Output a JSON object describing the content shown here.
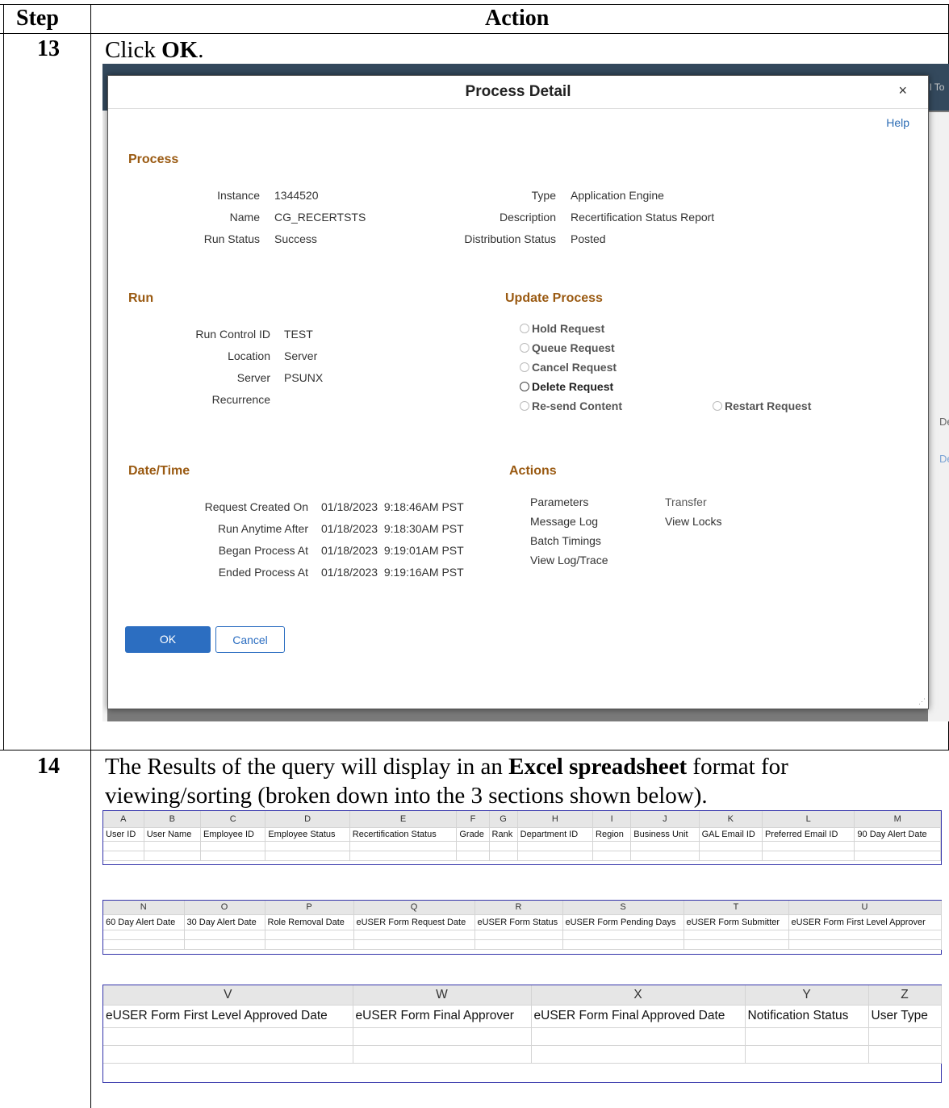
{
  "table_header": {
    "step": "Step",
    "action": "Action"
  },
  "steps": [
    {
      "number": "13",
      "text_before": "Click ",
      "text_bold": "OK",
      "text_after": "."
    },
    {
      "number": "14",
      "text_before": "The Results of the query will display in an ",
      "text_bold": "Excel spreadsheet",
      "text_after": " format for viewing/sorting (broken down into the 3 sections shown below)."
    }
  ],
  "background_fragments": {
    "top_right": "l To",
    "det1": "Det",
    "det2": "Det"
  },
  "dialog": {
    "title": "Process Detail",
    "close": "×",
    "help": "Help",
    "process": {
      "heading": "Process",
      "instance_label": "Instance",
      "instance": "1344520",
      "name_label": "Name",
      "name": "CG_RECERTSTS",
      "run_status_label": "Run Status",
      "run_status": "Success",
      "type_label": "Type",
      "type": "Application Engine",
      "description_label": "Description",
      "description": "Recertification Status Report",
      "distribution_label": "Distribution Status",
      "distribution": "Posted"
    },
    "run": {
      "heading": "Run",
      "run_control_label": "Run Control ID",
      "run_control": "TEST",
      "location_label": "Location",
      "location": "Server",
      "server_label": "Server",
      "server": "PSUNX",
      "recurrence_label": "Recurrence"
    },
    "update_process": {
      "heading": "Update Process",
      "options": [
        "Hold Request",
        "Queue Request",
        "Cancel Request",
        "Delete Request",
        "Re-send Content",
        "Restart Request"
      ]
    },
    "datetime": {
      "heading": "Date/Time",
      "created_label": "Request Created On",
      "created": "01/18/2023  9:18:46AM PST",
      "anytime_label": "Run Anytime After",
      "anytime": "01/18/2023  9:18:30AM PST",
      "began_label": "Began Process At",
      "began": "01/18/2023  9:19:01AM PST",
      "ended_label": "Ended Process At",
      "ended": "01/18/2023  9:19:16AM PST"
    },
    "actions": {
      "heading": "Actions",
      "parameters": "Parameters",
      "message_log": "Message Log",
      "batch_timings": "Batch Timings",
      "view_log": "View Log/Trace",
      "transfer": "Transfer",
      "view_locks": "View Locks"
    },
    "ok": "OK",
    "cancel": "Cancel"
  },
  "excel": [
    {
      "columns": [
        "A",
        "B",
        "C",
        "D",
        "E",
        "F",
        "G",
        "H",
        "I",
        "J",
        "K",
        "L",
        "M"
      ],
      "headers": [
        "User ID",
        "User Name",
        "Employee ID",
        "Employee Status",
        "Recertification Status",
        "Grade",
        "Rank",
        "Department ID",
        "Region",
        "Business Unit",
        "GAL Email ID",
        "Preferred Email ID",
        "90 Day Alert Date"
      ]
    },
    {
      "columns": [
        "N",
        "O",
        "P",
        "Q",
        "R",
        "S",
        "T",
        "U"
      ],
      "headers": [
        "60 Day Alert Date",
        "30 Day Alert Date",
        "Role Removal Date",
        "eUSER Form Request Date",
        "eUSER Form Status",
        "eUSER Form Pending Days",
        "eUSER Form Submitter",
        "eUSER Form First Level Approver"
      ]
    },
    {
      "columns": [
        "V",
        "W",
        "X",
        "Y",
        "Z"
      ],
      "headers": [
        "eUSER Form First Level Approved Date",
        "eUSER Form Final Approver",
        "eUSER Form Final Approved Date",
        "Notification Status",
        "User Type"
      ]
    }
  ]
}
